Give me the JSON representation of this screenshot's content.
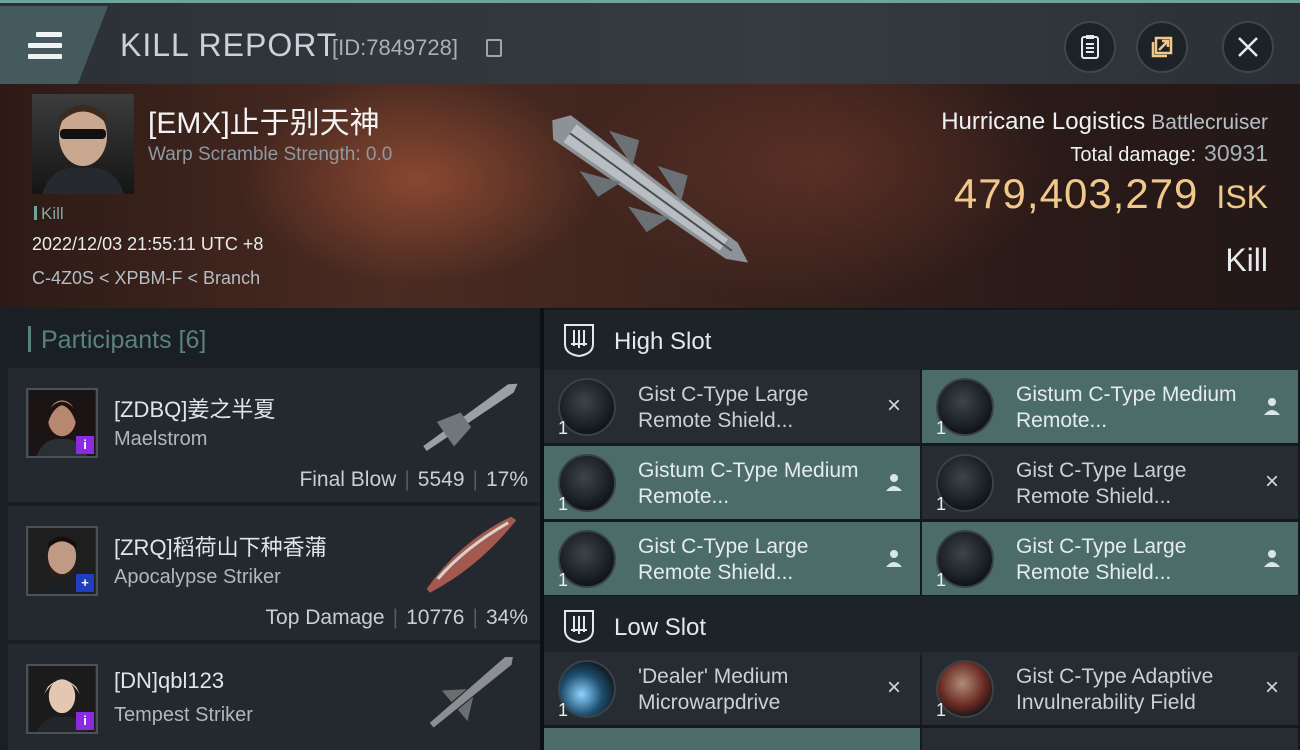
{
  "header": {
    "title": "KILL REPORT",
    "report_id": "[ID:7849728]"
  },
  "victim": {
    "pilot": "[EMX]止于别天神",
    "warp_scramble": "Warp Scramble Strength: 0.0",
    "tag": "Kill",
    "datetime": "2022/12/03 21:55:11 UTC +8",
    "location": "C-4Z0S < XPBM-F < Branch",
    "ship_name": "Hurricane Logistics",
    "ship_class": "Battlecruiser",
    "total_damage_label": "Total damage:",
    "total_damage": "30931",
    "isk_value": "479,403,279",
    "isk_unit": "ISK",
    "result": "Kill"
  },
  "participants": {
    "title": "Participants [6]",
    "items": [
      {
        "name": "[ZDBQ]姜之半夏",
        "ship": "Maelstrom",
        "role": "Final Blow",
        "damage": "5549",
        "percent": "17%",
        "badge": "i",
        "badge_color": "#8a2be2"
      },
      {
        "name": "[ZRQ]稻荷山下种香蒲",
        "ship": "Apocalypse Striker",
        "role": "Top Damage",
        "damage": "10776",
        "percent": "34%",
        "badge": "+",
        "badge_color": "#1f3fc0"
      },
      {
        "name": "[DN]qbl123",
        "ship": "Tempest Striker",
        "role": "",
        "damage": "",
        "percent": "",
        "badge": "i",
        "badge_color": "#8a2be2"
      }
    ]
  },
  "slots": {
    "high": {
      "title": "High Slot",
      "modules": [
        {
          "name": "Gist C-Type Large Remote Shield...",
          "qty": "1",
          "status": "×"
        },
        {
          "name": "Gistum C-Type Medium Remote...",
          "qty": "1",
          "status": "person"
        },
        {
          "name": "Gistum C-Type Medium Remote...",
          "qty": "1",
          "status": "person"
        },
        {
          "name": "Gist C-Type Large Remote Shield...",
          "qty": "1",
          "status": "×"
        },
        {
          "name": "Gist C-Type Large Remote Shield...",
          "qty": "1",
          "status": "person"
        },
        {
          "name": "Gist C-Type Large Remote Shield...",
          "qty": "1",
          "status": "person"
        }
      ]
    },
    "low": {
      "title": "Low Slot",
      "modules": [
        {
          "name": "'Dealer' Medium Microwarpdrive",
          "qty": "1",
          "status": "×"
        },
        {
          "name": "Gist C-Type Adaptive Invulnerability Field",
          "qty": "1",
          "status": "×"
        }
      ]
    }
  },
  "colors": {
    "accent": "#6fa39c",
    "isk": "#f0c98a",
    "highlight_row": "#4c6c69"
  }
}
